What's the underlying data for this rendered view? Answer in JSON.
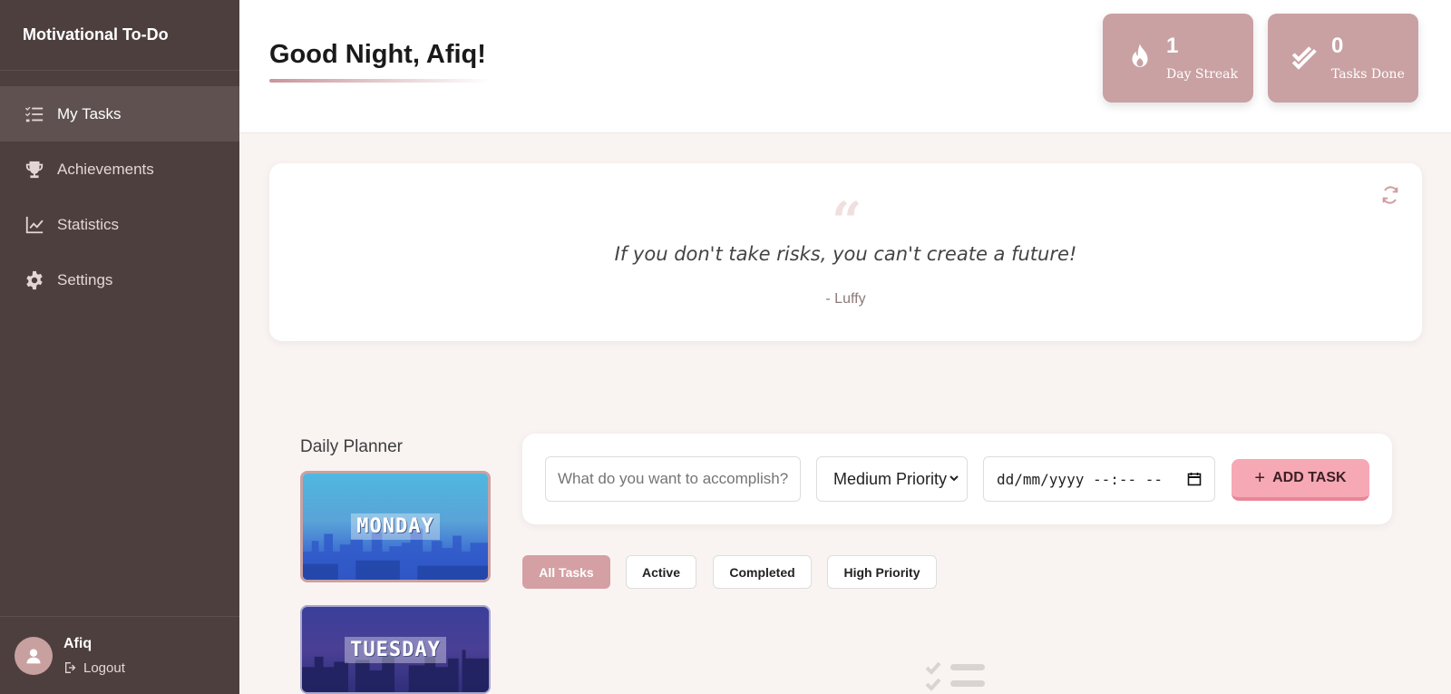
{
  "app": {
    "title": "Motivational To-Do"
  },
  "sidebar": {
    "items": [
      {
        "label": "My Tasks",
        "icon": "tasks-list-icon",
        "active": true
      },
      {
        "label": "Achievements",
        "icon": "trophy-icon",
        "active": false
      },
      {
        "label": "Statistics",
        "icon": "chart-line-icon",
        "active": false
      },
      {
        "label": "Settings",
        "icon": "gear-icon",
        "active": false
      }
    ],
    "user": {
      "name": "Afiq",
      "logout_label": "Logout"
    }
  },
  "header": {
    "greeting": "Good Night, Afiq!",
    "stats": {
      "streak": {
        "value": "1",
        "label": "Day Streak",
        "icon": "fire-icon"
      },
      "done": {
        "value": "0",
        "label": "Tasks Done",
        "icon": "double-check-icon"
      }
    }
  },
  "quote": {
    "mark": "“",
    "text": "If you don't take risks, you can't create a future!",
    "author": "- Luffy",
    "refresh_icon": "refresh-icon"
  },
  "planner": {
    "title": "Daily Planner",
    "days": [
      "MONDAY",
      "TUESDAY"
    ]
  },
  "task_form": {
    "placeholder": "What do you want to accomplish?",
    "priority": "Medium Priority",
    "date_placeholder": "dd/mm/yyyy --:-- --",
    "add_label": "ADD TASK"
  },
  "filters": [
    "All Tasks",
    "Active",
    "Completed",
    "High Priority"
  ],
  "colors": {
    "sidebar_bg": "#4d3f3e",
    "accent": "#c9a1a3",
    "add_button": "#f7a8b5",
    "page_bg": "#f9f4f2"
  }
}
